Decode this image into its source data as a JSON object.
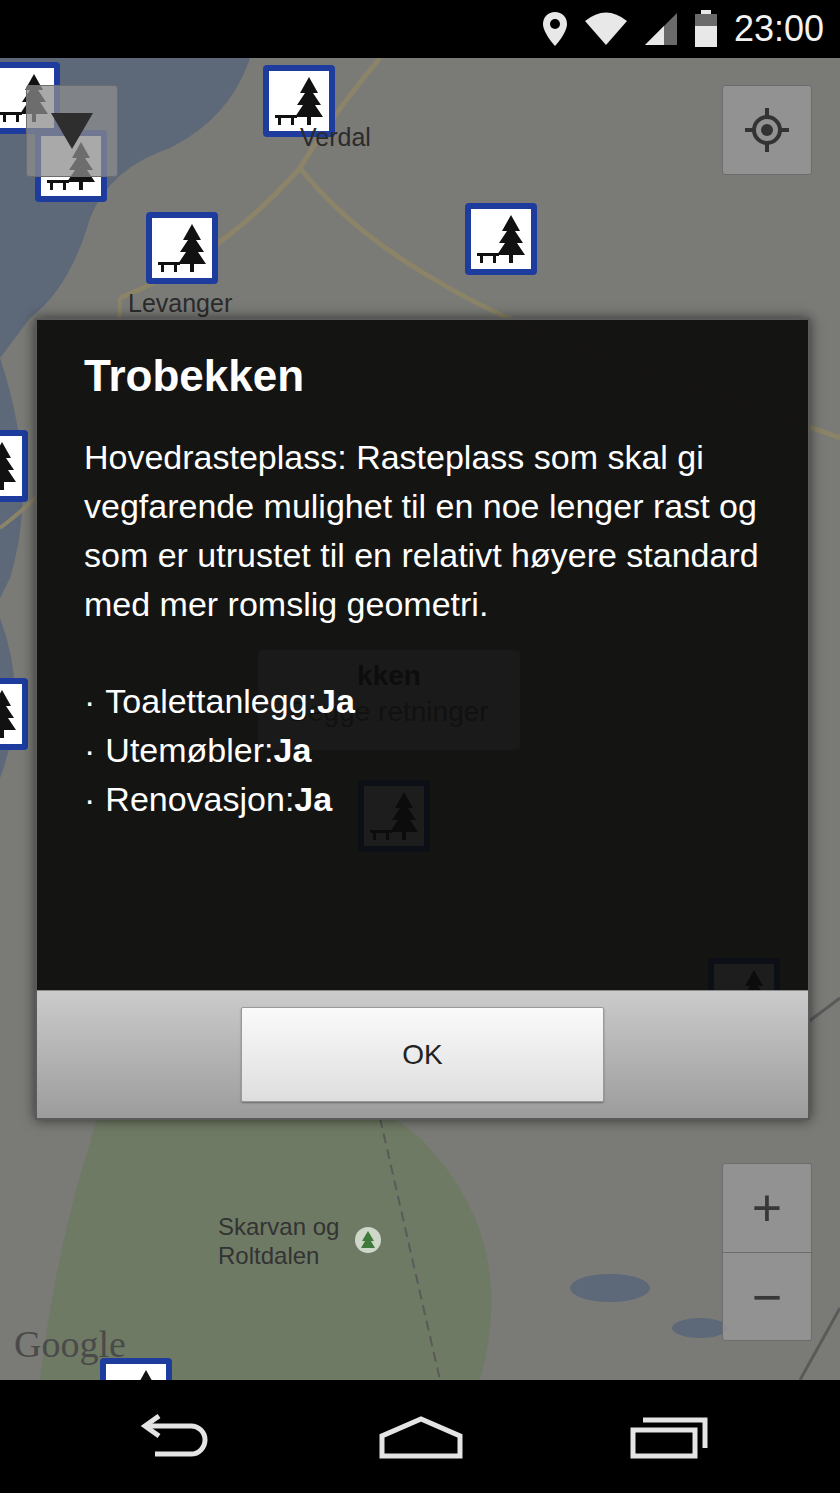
{
  "status_bar": {
    "time": "23:00"
  },
  "map": {
    "labels": [
      {
        "text": "Verdal"
      },
      {
        "text": "Levanger"
      },
      {
        "text": "Skarvan og Roltdalen"
      }
    ],
    "attribution": "Google",
    "zoom": {
      "in": "+",
      "out": "−"
    },
    "info_window": {
      "title": "kken",
      "subtitle": "Begge retninger"
    }
  },
  "dialog": {
    "title": "Trobekken",
    "description": "Hovedrasteplass: Rasteplass som skal gi vegfarende mulighet til en noe lenger rast og som er utrustet til en relativt høyere standard med mer romslig geometri.",
    "facilities": [
      {
        "bullet": "·",
        "label": "Toalettanlegg:",
        "value": "Ja"
      },
      {
        "bullet": "·",
        "label": "Utemøbler:",
        "value": "Ja"
      },
      {
        "bullet": "·",
        "label": "Renovasjon:",
        "value": "Ja"
      }
    ],
    "buttons": [
      "OK"
    ]
  }
}
